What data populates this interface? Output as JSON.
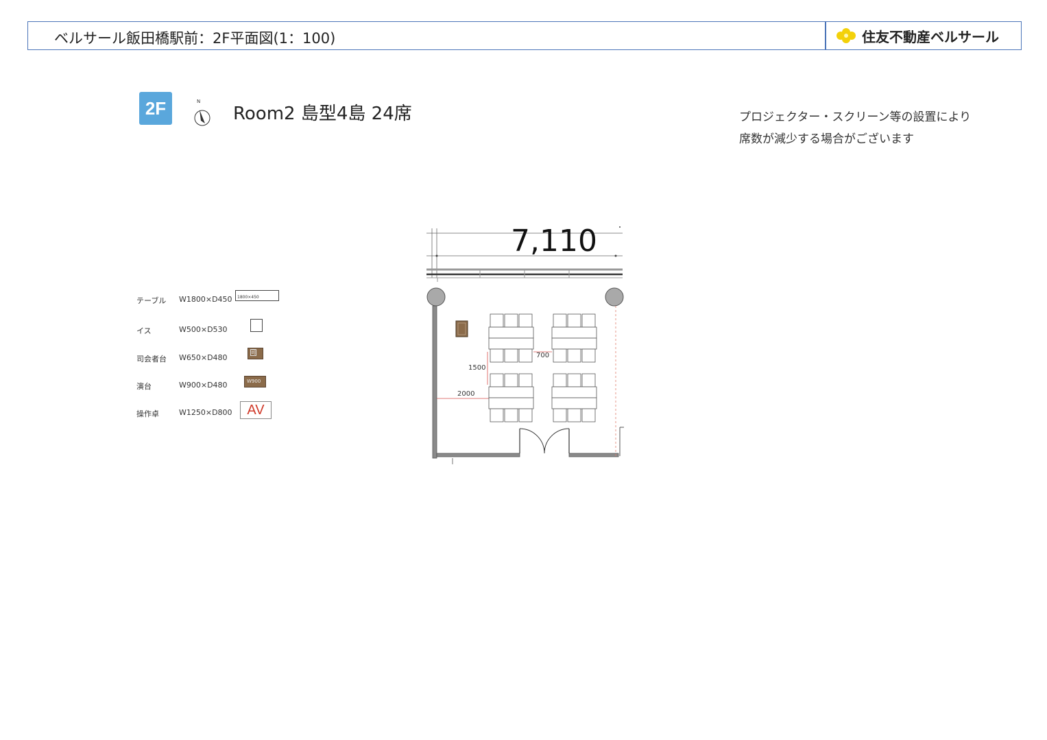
{
  "header": {
    "title": "ベルサール飯田橋駅前：2F平面図(1：100)",
    "logo_text": "住友不動産ベルサール",
    "logo_color": "#f3d10a",
    "border_color": "#4a74b8"
  },
  "floor_badge": {
    "label": "2F",
    "color": "#5aa7dc"
  },
  "compass": {
    "label": "N",
    "icon": "north-arrow-icon"
  },
  "room_title": "Room2 島型4島 24席",
  "notice": {
    "line1": "プロジェクター・スクリーン等の設置により",
    "line2": "席数が減少する場合がございます"
  },
  "legend": [
    {
      "name": "テーブル",
      "size": "W1800×D450",
      "swatch_text": "1800×450",
      "icon": "table-swatch-icon"
    },
    {
      "name": "イス",
      "size": "W500×D530",
      "swatch_text": "",
      "icon": "chair-swatch-icon"
    },
    {
      "name": "司会者台",
      "size": "W650×D480",
      "swatch_text": "司",
      "icon": "mc-podium-swatch-icon"
    },
    {
      "name": "演台",
      "size": "W900×D480",
      "swatch_text": "W900",
      "icon": "lectern-swatch-icon"
    },
    {
      "name": "操作卓",
      "size": "W1250×D800",
      "swatch_text": "AV",
      "icon": "av-desk-swatch-icon"
    }
  ],
  "floor_plan": {
    "overall_width_label": "7,110",
    "dim_horizontal_gap": "700",
    "dim_vertical_gap": "1500",
    "dim_wall_offset": "2000",
    "islands": 4,
    "seats_per_island": 6,
    "colors": {
      "wall": "#8a8a8a",
      "dimension_line": "#d9534f",
      "furniture_brown": "#8b6b4a",
      "column": "#a9a9a9"
    }
  }
}
